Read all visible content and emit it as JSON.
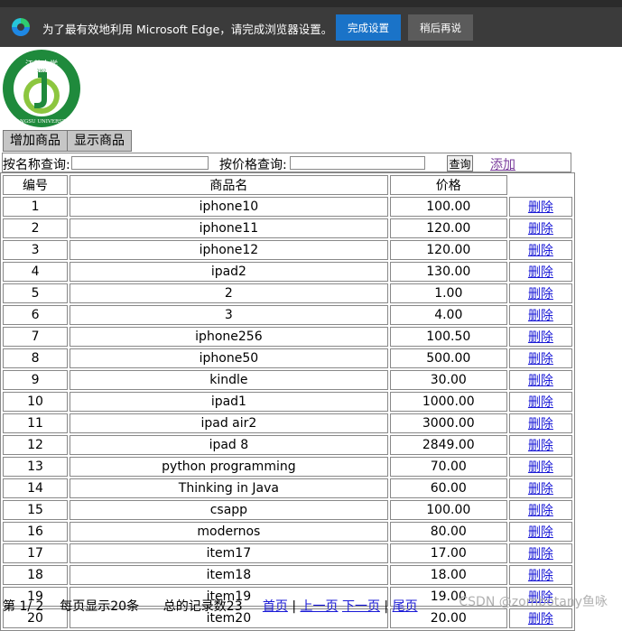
{
  "notification": {
    "message": "为了最有效地利用 Microsoft Edge，请完成浏览器设置。",
    "primary_button": "完成设置",
    "secondary_button": "稍后再说"
  },
  "logo": {
    "text_top": "江苏大学",
    "text_bottom": "JIANGSU UNIVERSITY",
    "year": "1902"
  },
  "tabs": [
    "增加商品",
    "显示商品"
  ],
  "search": {
    "name_label": "按名称查询:",
    "price_label": "按价格查询:",
    "query_button": "查询",
    "add_link": "添加"
  },
  "table": {
    "headers": [
      "编号",
      "商品名",
      "价格",
      ""
    ],
    "delete_label": "删除",
    "rows": [
      [
        "1",
        "iphone10",
        "100.00"
      ],
      [
        "2",
        "iphone11",
        "120.00"
      ],
      [
        "3",
        "iphone12",
        "120.00"
      ],
      [
        "4",
        "ipad2",
        "130.00"
      ],
      [
        "5",
        "2",
        "1.00"
      ],
      [
        "6",
        "3",
        "4.00"
      ],
      [
        "7",
        "iphone256",
        "100.50"
      ],
      [
        "8",
        "iphone50",
        "500.00"
      ],
      [
        "9",
        "kindle",
        "30.00"
      ],
      [
        "10",
        "ipad1",
        "1000.00"
      ],
      [
        "11",
        "ipad air2",
        "3000.00"
      ],
      [
        "12",
        "ipad 8",
        "2849.00"
      ],
      [
        "13",
        "python programming",
        "70.00"
      ],
      [
        "14",
        "Thinking in Java",
        "60.00"
      ],
      [
        "15",
        "csapp",
        "100.00"
      ],
      [
        "16",
        "modernos",
        "80.00"
      ],
      [
        "17",
        "item17",
        "17.00"
      ],
      [
        "18",
        "item18",
        "18.00"
      ],
      [
        "19",
        "item19",
        "19.00"
      ],
      [
        "20",
        "item20",
        "20.00"
      ]
    ]
  },
  "pager": {
    "page_info": "第 1/ 2",
    "per_page": "每页显示20条",
    "total": "总的记录数23",
    "first": "首页",
    "prev": "上一页",
    "next": "下一页",
    "last": "尾页",
    "sep": "|"
  },
  "watermark": "CSDN @zombotany鱼咏",
  "colors": {
    "edge_bar": "#3b3b3b",
    "primary": "#1a73c8",
    "link": "#1a1ad6",
    "visited": "#7a3d9c"
  }
}
